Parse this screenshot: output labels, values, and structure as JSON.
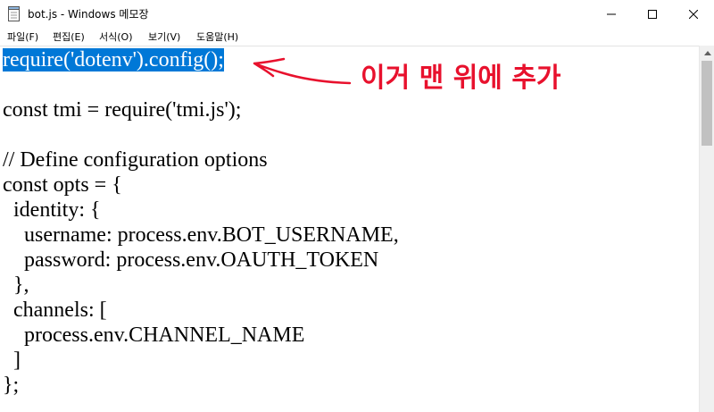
{
  "window": {
    "title": "bot.js - Windows 메모장",
    "icon": "notepad-icon",
    "controls": [
      "minimize-icon",
      "maximize-icon",
      "close-icon"
    ]
  },
  "menu": {
    "items": [
      "파일(F)",
      "편집(E)",
      "서식(O)",
      "보기(V)",
      "도움말(H)"
    ]
  },
  "editor": {
    "selected_line": "require('dotenv').config();",
    "lines": [
      "",
      "const tmi = require('tmi.js');",
      "",
      "// Define configuration options",
      "const opts = {",
      "  identity: {",
      "    username: process.env.BOT_USERNAME,",
      "    password: process.env.OAUTH_TOKEN",
      "  },",
      "  channels: [",
      "    process.env.CHANNEL_NAME",
      "  ]",
      "};"
    ]
  },
  "annotation": {
    "text": "이거 맨 위에 추가",
    "color": "#e8112d"
  },
  "colors": {
    "selection": "#0078d7"
  }
}
